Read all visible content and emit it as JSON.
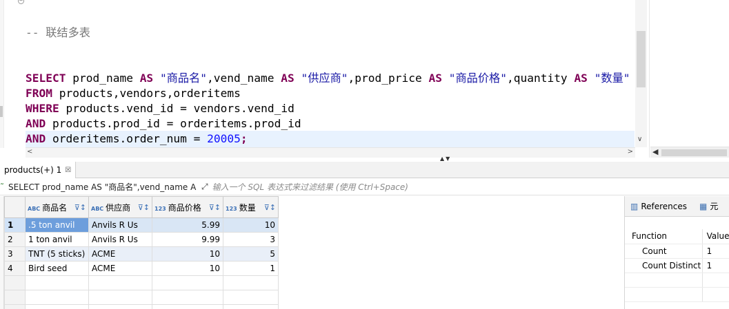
{
  "editor": {
    "comment": "-- 联结多表",
    "lines": [
      [
        {
          "t": "SELECT",
          "c": "kw"
        },
        {
          "t": " prod_name ",
          "c": ""
        },
        {
          "t": "AS",
          "c": "kw"
        },
        {
          "t": " ",
          "c": ""
        },
        {
          "t": "\"商品名\"",
          "c": "str"
        },
        {
          "t": ",vend_name ",
          "c": ""
        },
        {
          "t": "AS",
          "c": "kw"
        },
        {
          "t": " ",
          "c": ""
        },
        {
          "t": "\"供应商\"",
          "c": "str"
        },
        {
          "t": ",prod_price ",
          "c": ""
        },
        {
          "t": "AS",
          "c": "kw"
        },
        {
          "t": " ",
          "c": ""
        },
        {
          "t": "\"商品价格\"",
          "c": "str"
        },
        {
          "t": ",quantity ",
          "c": ""
        },
        {
          "t": "AS",
          "c": "kw"
        },
        {
          "t": " ",
          "c": ""
        },
        {
          "t": "\"数量\"",
          "c": "str"
        }
      ],
      [
        {
          "t": "FROM",
          "c": "kw"
        },
        {
          "t": " products,vendors,orderitems",
          "c": ""
        }
      ],
      [
        {
          "t": "WHERE",
          "c": "kw"
        },
        {
          "t": " products.vend_id = vendors.vend_id",
          "c": ""
        }
      ],
      [
        {
          "t": "AND",
          "c": "kw"
        },
        {
          "t": " products.prod_id = orderitems.prod_id",
          "c": ""
        }
      ],
      [
        {
          "t": "AND",
          "c": "kw"
        },
        {
          "t": " orderitems.order_num = ",
          "c": ""
        },
        {
          "t": "20005",
          "c": "num"
        },
        {
          "t": ";",
          "c": "kw"
        }
      ]
    ]
  },
  "tab": {
    "label": "products(+) 1",
    "close": "☒"
  },
  "filter": {
    "query": "SELECT prod_name AS \"商品名\",vend_name A",
    "placeholder": "输入一个 SQL 表达式来过滤结果 (使用 Ctrl+Space)"
  },
  "grid": {
    "columns": [
      {
        "type": "ABC",
        "name": "商品名"
      },
      {
        "type": "ABC",
        "name": "供应商"
      },
      {
        "type": "123",
        "name": "商品价格"
      },
      {
        "type": "123",
        "name": "数量"
      }
    ],
    "rows": [
      {
        "num": "1",
        "cells": [
          ".5 ton anvil",
          "Anvils R Us",
          "5.99",
          "10"
        ]
      },
      {
        "num": "2",
        "cells": [
          "1 ton anvil",
          "Anvils R Us",
          "9.99",
          "3"
        ]
      },
      {
        "num": "3",
        "cells": [
          "TNT (5 sticks)",
          "ACME",
          "10",
          "5"
        ]
      },
      {
        "num": "4",
        "cells": [
          "Bird seed",
          "ACME",
          "10",
          "1"
        ]
      }
    ]
  },
  "refs": {
    "tab_label": "References",
    "tab2_label": "元",
    "headers": {
      "function": "Function",
      "value": "Value"
    },
    "rows": [
      {
        "function": "Count",
        "value": "1"
      },
      {
        "function": "Count Distinct",
        "value": "1"
      }
    ]
  }
}
